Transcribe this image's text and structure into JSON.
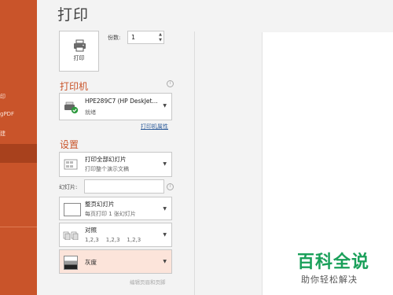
{
  "sidebar": {
    "items": [
      {
        "label": "印"
      },
      {
        "label": "gPDF"
      },
      {
        "label": "建"
      }
    ]
  },
  "title": "打印",
  "print_button": {
    "label": "打印",
    "icon": "printer-icon"
  },
  "copies": {
    "label": "份数:",
    "value": "1"
  },
  "printer_section": {
    "title": "打印机"
  },
  "printer": {
    "name": "HPE289C7 (HP DeskJet...",
    "status": "就绪",
    "icon": "printer-ready-icon"
  },
  "printer_properties_link": "打印机属性",
  "settings_section": {
    "title": "设置"
  },
  "print_range": {
    "line1": "打印全部幻灯片",
    "line2": "打印整个演示文稿"
  },
  "slides": {
    "label": "幻灯片:",
    "value": ""
  },
  "layout": {
    "line1": "整页幻灯片",
    "line2": "每页打印 1 张幻灯片"
  },
  "collation": {
    "line1": "对照",
    "line2": "1,2,3    1,2,3    1,2,3"
  },
  "color_mode": {
    "line1": "灰度"
  },
  "footer_link": "编辑页眉和页脚",
  "watermark": {
    "title": "百科全说",
    "subtitle": "助你轻松解决"
  },
  "colors": {
    "accent": "#c9542a",
    "link": "#2e5c9a",
    "watermark": "#1aa05a",
    "grayscale_bg": "#fce4da"
  }
}
